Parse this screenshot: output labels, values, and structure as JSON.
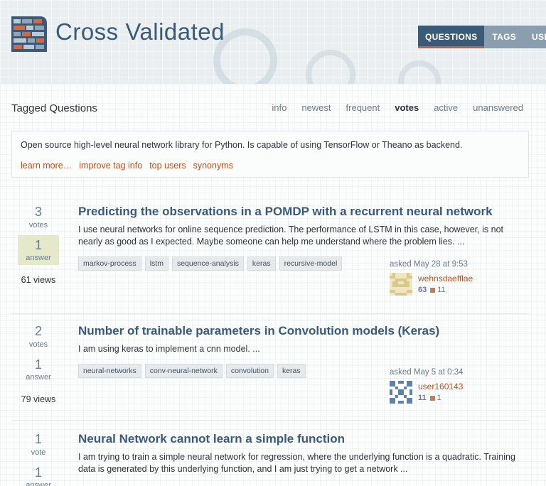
{
  "site": {
    "name": "Cross Validated",
    "nav": [
      {
        "label": "QUESTIONS",
        "active": true
      },
      {
        "label": "TAGS",
        "active": false
      },
      {
        "label": "USER",
        "active": false
      }
    ]
  },
  "subheader": {
    "title": "Tagged Questions",
    "tabs": [
      "info",
      "newest",
      "frequent",
      "votes",
      "active",
      "unanswered"
    ],
    "active_tab": "votes"
  },
  "tag_wiki": {
    "excerpt": "Open source high-level neural network library for Python. Is capable of using TensorFlow or Theano as backend.",
    "links": [
      "learn more…",
      "improve tag info",
      "top users",
      "synonyms"
    ]
  },
  "questions": [
    {
      "votes": "3",
      "votes_label": "votes",
      "answers": "1",
      "answers_label": "answer",
      "accepted": true,
      "views": "61 views",
      "title": "Predicting the observations in a POMDP with a recurrent neural network",
      "excerpt": "I use neural networks for online sequence prediction. The performance of LSTM in this case, however, is not nearly as good as I expected. Maybe someone can help me understand where the problem lies. ...",
      "tags": [
        "markov-process",
        "lstm",
        "sequence-analysis",
        "keras",
        "recursive-model"
      ],
      "asked": "asked May 28 at 9:53",
      "user": "wehnsdaefflae",
      "reputation": "63",
      "bronze_badges": "11"
    },
    {
      "votes": "2",
      "votes_label": "votes",
      "answers": "1",
      "answers_label": "answer",
      "accepted": false,
      "views": "79 views",
      "title": "Number of trainable parameters in Convolution models (Keras)",
      "excerpt": "I am using keras to implement a cnn model. ...",
      "tags": [
        "neural-networks",
        "conv-neural-network",
        "convolution",
        "keras"
      ],
      "asked": "asked May 5 at 0:34",
      "user": "user160143",
      "reputation": "11",
      "bronze_badges": "1"
    },
    {
      "votes": "1",
      "votes_label": "vote",
      "answers": "1",
      "answers_label": "answer",
      "accepted": false,
      "title": "Neural Network cannot learn a simple function",
      "excerpt": "I am trying to train a simple neural network for regression, where the underlying function is a quadratic. Training data is generated by this underlying function, and I am just trying to get a network ..."
    }
  ],
  "colors": {
    "brand": "#3b5a77",
    "accent": "#c95f3c",
    "link": "#b4531f",
    "accepted_bg": "#e5e8c9"
  }
}
